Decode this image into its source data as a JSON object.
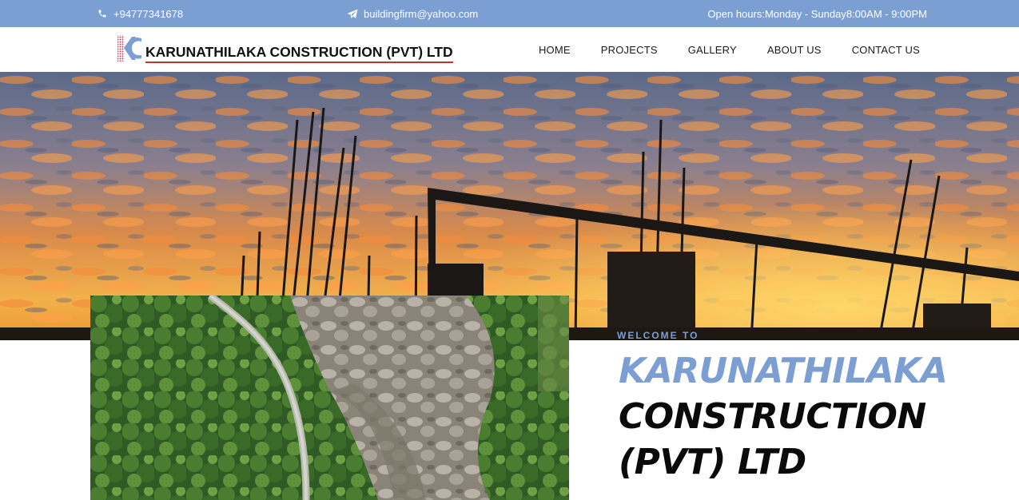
{
  "topbar": {
    "phone": "+94777341678",
    "email": "buildingfirm@yahoo.com",
    "hours": "Open hours:Monday - Sunday8:00AM - 9:00PM",
    "phone_icon": "phone-icon",
    "email_icon": "paper-plane-icon"
  },
  "header": {
    "logo_text": "KARUNATHILAKA CONSTRUCTION (PVT) LTD",
    "nav": [
      "HOME",
      "PROJECTS",
      "GALLERY",
      "ABOUT US",
      "CONTACT US"
    ]
  },
  "hero": {
    "welcome": "WELCOME TO",
    "title_line1": "KARUNATHILAKA",
    "title_line2": "CONSTRUCTION",
    "title_line3": "(PVT) LTD"
  },
  "colors": {
    "accent": "#7b9fd2",
    "logo_underline": "#c4342d",
    "text_dark": "#0a0a0a"
  }
}
